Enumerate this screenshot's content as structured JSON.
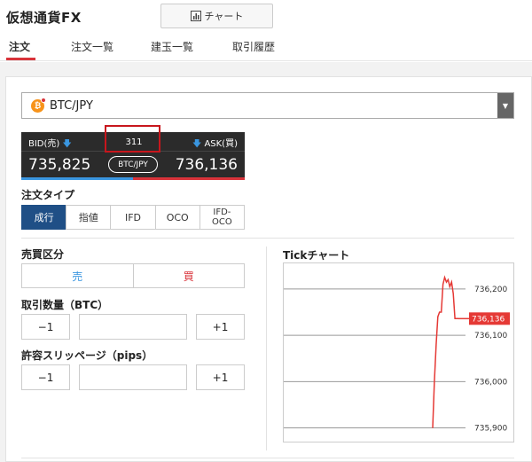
{
  "app": {
    "title": "仮想通貨FX"
  },
  "toolbar": {
    "chart_label": "チャート"
  },
  "tabs": [
    {
      "label": "注文",
      "active": true
    },
    {
      "label": "注文一覧"
    },
    {
      "label": "建玉一覧"
    },
    {
      "label": "取引履歴"
    }
  ],
  "pair_select": {
    "value": "BTC/JPY",
    "coin_symbol": "₿"
  },
  "rate": {
    "bid_label": "BID(売)",
    "ask_label": "ASK(買)",
    "spread": "311",
    "bid": "735,825",
    "ask": "736,136",
    "pair": "BTC/JPY"
  },
  "order_type": {
    "label": "注文タイプ",
    "options": [
      "成行",
      "指値",
      "IFD",
      "OCO",
      "IFD-\nOCO"
    ],
    "selected": "成行"
  },
  "side": {
    "label": "売買区分",
    "sell": "売",
    "buy": "買"
  },
  "quantity": {
    "label": "取引数量（BTC）",
    "minus": "−1",
    "plus": "+1",
    "value": ""
  },
  "slippage": {
    "label": "許容スリッページ（pips）",
    "minus": "−1",
    "plus": "+1",
    "value": ""
  },
  "tick_chart": {
    "title": "Tickチャート",
    "current_label": "736,136"
  },
  "colors": {
    "accent": "#d9333a",
    "bid": "#3a96e0",
    "active_tab_bg": "#1f4f86",
    "btc": "#f7931a"
  },
  "chart_data": {
    "type": "line",
    "title": "Tickチャート",
    "ylim": [
      735880,
      736240
    ],
    "yticks": [
      736200,
      736100,
      736000,
      735900
    ],
    "ytick_labels": [
      "736,200",
      "736,100",
      "736,000",
      "735,900"
    ],
    "current": 736136,
    "series": [
      {
        "values": [
          735900,
          736000,
          736080,
          736140,
          736150,
          736150,
          736210,
          736225,
          736215,
          736220,
          736205,
          736215,
          736190,
          736136,
          736136,
          736136
        ]
      }
    ]
  }
}
